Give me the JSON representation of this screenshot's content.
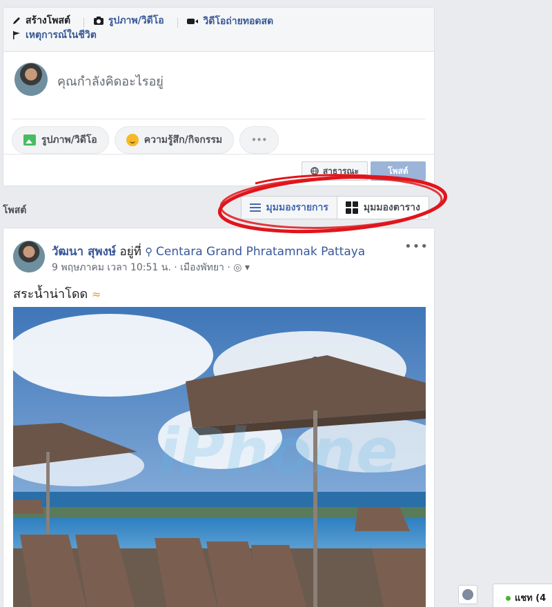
{
  "composer": {
    "tabs": [
      {
        "label": "สร้างโพสต์",
        "icon": "pencil-icon"
      },
      {
        "label": "รูปภาพ/วิดีโอ",
        "icon": "camera-icon"
      },
      {
        "label": "วิดีโอถ่ายทอดสด",
        "icon": "video-camera-icon"
      },
      {
        "label": "เหตุการณ์ในชีวิต",
        "icon": "flag-icon"
      }
    ],
    "placeholder": "คุณกำลังคิดอะไรอยู่",
    "actions": [
      {
        "label": "รูปภาพ/วิดีโอ",
        "icon": "photo-icon"
      },
      {
        "label": "ความรู้สึก/กิจกรรม",
        "icon": "smiley-icon"
      },
      {
        "label": "•••",
        "icon": "more-icon"
      }
    ],
    "audience_label": "สาธารณะ",
    "post_label": "โพสต์"
  },
  "posts_section": {
    "title": "โพสต์",
    "list_view_label": "มุมมองรายการ",
    "grid_view_label": "มุมมองตาราง"
  },
  "post": {
    "author": "วัฒนา สุพงษ์",
    "at_text": " อยู่ที่ ",
    "location": "Centara Grand Phratamnak Pattaya",
    "meta": "9 พฤษภาคม เวลา 10:51 น. · เมืองพัทยา · ",
    "text": "สระน้ำน่าโดด",
    "more": "•••",
    "watermark": "iPhone"
  },
  "chat": {
    "label": "แชท (4"
  },
  "colors": {
    "link": "#385898",
    "accent": "#4267b2",
    "annotation": "#e0151b",
    "background": "#e9ebee"
  }
}
